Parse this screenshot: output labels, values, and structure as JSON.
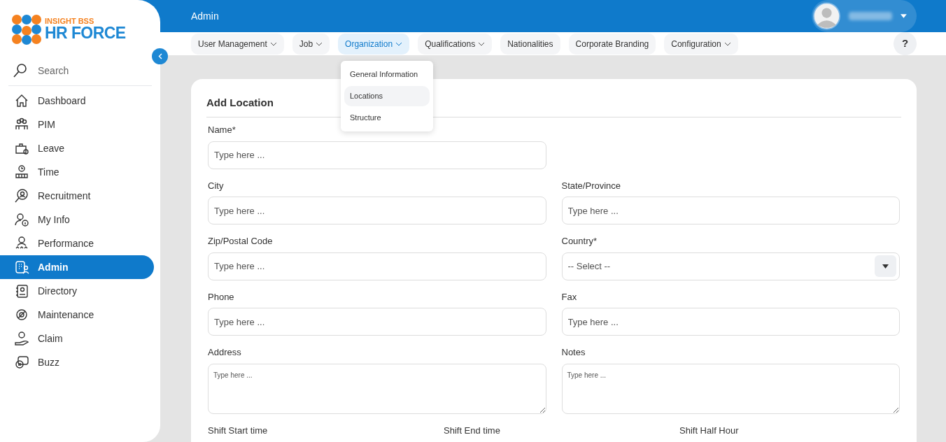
{
  "logo": {
    "top_line": "INSIGHT BSS",
    "bottom_line": "HR FORCE"
  },
  "sidebar": {
    "search": {
      "placeholder": "Search"
    },
    "items": [
      {
        "label": "Dashboard",
        "selected": false
      },
      {
        "label": "PIM",
        "selected": false
      },
      {
        "label": "Leave",
        "selected": false
      },
      {
        "label": "Time",
        "selected": false
      },
      {
        "label": "Recruitment",
        "selected": false
      },
      {
        "label": "My Info",
        "selected": false
      },
      {
        "label": "Performance",
        "selected": false
      },
      {
        "label": "Admin",
        "selected": true
      },
      {
        "label": "Directory",
        "selected": false
      },
      {
        "label": "Maintenance",
        "selected": false
      },
      {
        "label": "Claim",
        "selected": false
      },
      {
        "label": "Buzz",
        "selected": false
      }
    ]
  },
  "header": {
    "title": "Admin"
  },
  "top_nav": {
    "tabs": [
      {
        "label": "User Management",
        "has_menu": true,
        "selected": false
      },
      {
        "label": "Job",
        "has_menu": true,
        "selected": false
      },
      {
        "label": "Organization",
        "has_menu": true,
        "selected": true
      },
      {
        "label": "Qualifications",
        "has_menu": true,
        "selected": false
      },
      {
        "label": "Nationalities",
        "has_menu": false,
        "selected": false
      },
      {
        "label": "Corporate Branding",
        "has_menu": false,
        "selected": false
      },
      {
        "label": "Configuration",
        "has_menu": true,
        "selected": false
      }
    ],
    "help": "?",
    "dropdown": [
      {
        "label": "General Information",
        "selected": false
      },
      {
        "label": "Locations",
        "selected": true
      },
      {
        "label": "Structure",
        "selected": false
      }
    ]
  },
  "form": {
    "title": "Add Location",
    "rows": [
      [
        {
          "label": "Name*",
          "kind": "text",
          "placeholder": "Type here ..."
        }
      ],
      [
        {
          "label": "City",
          "kind": "text",
          "placeholder": "Type here ..."
        },
        {
          "label": "State/Province",
          "kind": "text",
          "placeholder": "Type here ..."
        }
      ],
      [
        {
          "label": "Zip/Postal Code",
          "kind": "text",
          "placeholder": "Type here ..."
        },
        {
          "label": "Country*",
          "kind": "select",
          "value": "-- Select --"
        }
      ],
      [
        {
          "label": "Phone",
          "kind": "text",
          "placeholder": "Type here ..."
        },
        {
          "label": "Fax",
          "kind": "text",
          "placeholder": "Type here ..."
        }
      ],
      [
        {
          "label": "Address",
          "kind": "textarea",
          "placeholder": "Type here ..."
        },
        {
          "label": "Notes",
          "kind": "textarea",
          "placeholder": "Type here ..."
        }
      ]
    ],
    "shift_labels": [
      "Shift Start time",
      "Shift End time",
      "Shift Half Hour"
    ]
  }
}
